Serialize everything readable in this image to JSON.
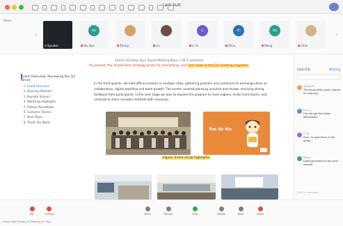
{
  "window": {
    "title": "Lark Suit"
  },
  "stage": {
    "label": "Share"
  },
  "participants": [
    {
      "name": "Speaker",
      "color": "#2a2f36"
    },
    {
      "name": "Wu Hao",
      "color": "#2a9d8f",
      "initials": "Wu"
    },
    {
      "name": "Zhang",
      "color": "#d9a066"
    },
    {
      "name": "Lin",
      "color": "#6b4e3d"
    },
    {
      "name": "Li Yu",
      "color": "#6a5acd",
      "initials": "Li"
    },
    {
      "name": "Zhou",
      "color": "#2d6fb2",
      "initials": "Zh"
    },
    {
      "name": "Wang",
      "color": "#2a9d8f",
      "initials": "Wa"
    },
    {
      "name": "Chen",
      "color": "#d2b48c"
    }
  ],
  "doc": {
    "meta": "2024·5·18   Feishu Docs   Shared Meeting Notes   1.3K   0 comments",
    "line1_red": "At present, the mobile-first strategy works for everything, and",
    "line1_highlight": "Let's look at the Q3 roadmap together",
    "para": "In the third quarter, we held offline sessions in multiple cities, gathering partners and customers to exchange ideas on collaboration, digital workflow and team growth. The events covered planning, practice and review, receiving strong feedback from participants. In the next stage we plan to expand the program to more regions, invite more teams, and continue to share reusable methods with everyone.",
    "banner_text": "Yes Or No",
    "caption": "Figure: Event recap highlights",
    "outline_title": "Event Overview: Reviewing the Q3 Series",
    "outline": [
      "1. Event Overview",
      "2. Opening Remarks",
      "3. Keynote Session",
      "4. Workshop Highlights",
      "5. Partner Roundtable",
      "6. Customer Stories",
      "7. Next Steps",
      "8. Thank You Notes"
    ]
  },
  "chat": {
    "header": "Chat (74)",
    "tab": "Meeting",
    "messages": [
      {
        "name": "Zhang Yi",
        "text": "The recap looks great, thanks for sharing!"
      },
      {
        "name": "Lin Lu",
        "text": "Can we get the slides afterwards?"
      },
      {
        "name": "Li Yu",
        "text": "Sure, I'll post them in the group."
      },
      {
        "name": "Wang",
        "text": "Looking forward to the next session."
      }
    ],
    "input_placeholder": "Send a message..."
  },
  "controls": [
    {
      "label": "Mic"
    },
    {
      "label": "Camera"
    },
    {
      "label": "Share"
    },
    {
      "label": "Record"
    },
    {
      "label": "Chat"
    },
    {
      "label": "People"
    },
    {
      "label": "More"
    },
    {
      "label": "Leave"
    }
  ],
  "footer": "Small Field Studio & Meeting in Prog."
}
